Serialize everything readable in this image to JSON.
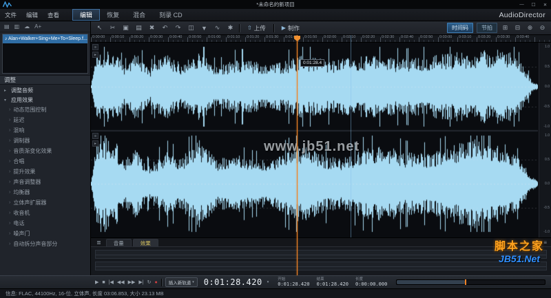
{
  "window": {
    "title": "*未命名的新项目",
    "brand": "AudioDirector",
    "controls": [
      "—",
      "☐",
      "✕"
    ]
  },
  "menu": {
    "items": [
      "文件",
      "编辑",
      "查看"
    ],
    "modes": [
      {
        "label": "编辑",
        "active": true
      },
      {
        "label": "恢复",
        "active": false
      },
      {
        "label": "混合",
        "active": false
      },
      {
        "label": "刻录 CD",
        "active": false
      }
    ]
  },
  "library": {
    "toolbar_icons": [
      {
        "name": "import-media-icon",
        "glyph": "▤"
      },
      {
        "name": "import-folder-icon",
        "glyph": "▥"
      },
      {
        "name": "cloud-icon",
        "glyph": "☁"
      },
      {
        "name": "text-size-icon",
        "glyph": "A+"
      }
    ],
    "track": "♪ Alan+Walker+Sing+Me+To+Sleep.f..."
  },
  "adjust_panel": {
    "header": "调整",
    "groups": [
      {
        "label": "调整音频",
        "expanded": false,
        "items": []
      },
      {
        "label": "应用效果",
        "expanded": true,
        "items": [
          "动态范围控制",
          "延迟",
          "混响",
          "调制器",
          "音质渐变化效果",
          "合唱",
          "提升效果",
          "声音调整器",
          "均衡器",
          "立体声扩展器",
          "收音机",
          "电话",
          "噪声门",
          "自动拆分声音部分"
        ]
      }
    ]
  },
  "toolbar": {
    "icons": [
      {
        "name": "select-tool-icon",
        "glyph": "↖"
      },
      {
        "name": "cut-icon",
        "glyph": "✂"
      },
      {
        "name": "copy-icon",
        "glyph": "▣"
      },
      {
        "name": "paste-icon",
        "glyph": "▤"
      },
      {
        "name": "delete-icon",
        "glyph": "✖"
      },
      {
        "name": "undo-icon",
        "glyph": "↶"
      },
      {
        "name": "redo-icon",
        "glyph": "↷"
      },
      {
        "name": "split-icon",
        "glyph": "◫"
      },
      {
        "name": "marker-icon",
        "glyph": "▼"
      },
      {
        "name": "waveform-tool-icon",
        "glyph": "∿"
      },
      {
        "name": "tools-dropdown-icon",
        "glyph": "✱"
      }
    ],
    "upload_glyph": "⇧",
    "upload_label": "上传",
    "produce_glyph": "▶",
    "produce_label": "制作",
    "timecode_label": "时间码",
    "beats_label": "节拍",
    "right_icons": [
      {
        "name": "grid-view-icon",
        "glyph": "⊞"
      },
      {
        "name": "single-view-icon",
        "glyph": "⊟"
      },
      {
        "name": "zoom-in-icon",
        "glyph": "⊕"
      },
      {
        "name": "zoom-out-icon",
        "glyph": "⊖"
      }
    ]
  },
  "ruler": {
    "labels": [
      "0:00:00",
      "0:00:10",
      "0:00:20",
      "0:00:30",
      "0:00:40",
      "0:00:50",
      "0:01:00",
      "0:01:10",
      "0:01:20",
      "0:01:30",
      "0:01:40",
      "0:01:50",
      "0:02:00",
      "0:02:10",
      "0:02:20",
      "0:02:30",
      "0:02:40",
      "0:02:50",
      "0:03:00",
      "0:03:10",
      "0:03:20",
      "0:03:30",
      "0:03:40"
    ]
  },
  "waveform": {
    "tooltip": "0:01:28.4",
    "watermark": "www.jb51.net",
    "scale_labels": [
      "1.0",
      "0.5",
      "0.0",
      "-0.5",
      "-1.0"
    ],
    "badge_glyphs": [
      "≡",
      "▸"
    ]
  },
  "keyframe": {
    "menu_glyph": "≣",
    "tabs": [
      {
        "label": "音量",
        "active": false
      },
      {
        "label": "效果",
        "active": true
      }
    ],
    "right_icons": [
      {
        "name": "add-keyframe-icon",
        "glyph": "✚"
      },
      {
        "name": "keyframe-menu-icon",
        "glyph": "≡"
      }
    ]
  },
  "watermark_logo": {
    "line1": "脚本之家",
    "line2": "JB51.Net"
  },
  "transport": {
    "icons": [
      {
        "name": "play-button",
        "glyph": "▶"
      },
      {
        "name": "stop-button",
        "glyph": "■"
      },
      {
        "name": "prev-button",
        "glyph": "|◀"
      },
      {
        "name": "rewind-button",
        "glyph": "◀◀"
      },
      {
        "name": "forward-button",
        "glyph": "▶▶"
      },
      {
        "name": "next-button",
        "glyph": "▶|"
      },
      {
        "name": "loop-button",
        "glyph": "↻"
      },
      {
        "name": "record-button",
        "glyph": "●",
        "rec": true
      }
    ],
    "insert_label": "插入新轨道",
    "time": "0:01:28.420",
    "fields": [
      {
        "label": "开始",
        "value": "0:01:28.420"
      },
      {
        "label": "结束",
        "value": "0:01:28.420"
      },
      {
        "label": "长度",
        "value": "0:00:00.000"
      }
    ]
  },
  "status": {
    "info": "信息: FLAC, 44100Hz, 16-位, 立体声, 长度 03:06.853, 大小 23.13 MB"
  }
}
